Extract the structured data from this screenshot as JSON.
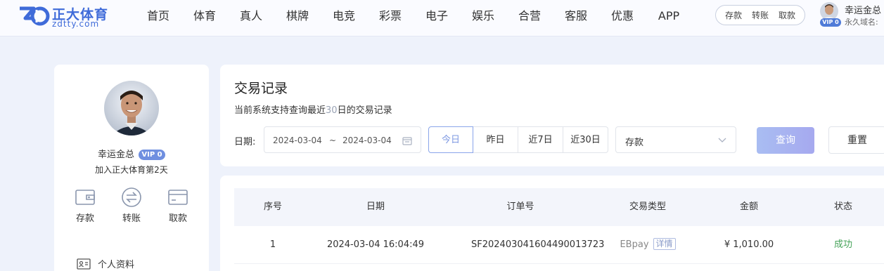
{
  "brand": {
    "name": "正大体育",
    "url": "zdtty.com",
    "mark_color": "#3f6bd9"
  },
  "nav": {
    "items": [
      "首页",
      "体育",
      "真人",
      "棋牌",
      "电竞",
      "彩票",
      "电子",
      "娱乐",
      "合营",
      "客服",
      "优惠",
      "APP"
    ]
  },
  "header_quick": {
    "deposit": "存款",
    "transfer": "转账",
    "withdraw": "取款"
  },
  "user": {
    "name": "幸运金总",
    "vip": "VIP 0",
    "domain_label": "永久域名:",
    "days_text": "加入正大体育第2天"
  },
  "side_actions": [
    {
      "label": "存款",
      "icon": "wallet-icon"
    },
    {
      "label": "转账",
      "icon": "transfer-icon"
    },
    {
      "label": "取款",
      "icon": "card-icon"
    }
  ],
  "side_menu": [
    {
      "label": "个人资料",
      "icon": "id-card-icon"
    }
  ],
  "query": {
    "title": "交易记录",
    "subtitle_prefix": "当前系统支持查询最近",
    "subtitle_highlight": "30",
    "subtitle_suffix": "日的交易记录",
    "date_label": "日期:",
    "start_date": "2024-03-04",
    "range_sep": "~",
    "end_date": "2024-03-04",
    "quick_ranges": [
      "今日",
      "昨日",
      "近7日",
      "近30日"
    ],
    "active_range": "今日",
    "type_value": "存款",
    "search_label": "查询",
    "reset_label": "重置"
  },
  "table": {
    "headers": [
      "序号",
      "日期",
      "订单号",
      "交易类型",
      "金额",
      "状态"
    ],
    "rows": [
      {
        "index": "1",
        "date": "2024-03-04 16:04:49",
        "order_no": "SF202403041604490013723",
        "type": "EBpay",
        "detail_label": "详情",
        "amount": "¥ 1,010.00",
        "status": "成功"
      }
    ]
  },
  "colors": {
    "accent": "#3f6bd9",
    "success": "#46a35a",
    "page_bg": "#eef2fb"
  }
}
